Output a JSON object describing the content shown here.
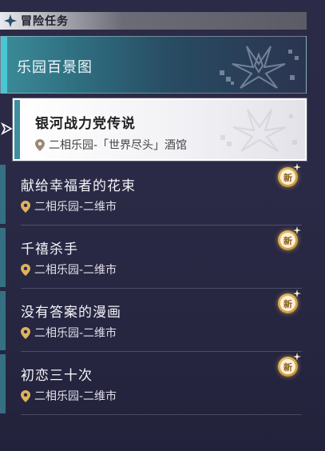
{
  "header": {
    "title": "冒险任务"
  },
  "category": {
    "label": "乐园百景图"
  },
  "selected_quest": {
    "title": "银河战力党传说",
    "location": "二相乐园-「世界尽头」酒馆"
  },
  "quests": [
    {
      "title": "献给幸福者的花束",
      "location": "二相乐园-二维市",
      "badge": "新"
    },
    {
      "title": "千禧杀手",
      "location": "二相乐园-二维市",
      "badge": "新"
    },
    {
      "title": "没有答案的漫画",
      "location": "二相乐园-二维市",
      "badge": "新"
    },
    {
      "title": "初恋三十次",
      "location": "二相乐园-二维市",
      "badge": "新"
    }
  ],
  "colors": {
    "accent_teal": "#49c6d3",
    "badge_gold": "#d39b3a",
    "background": "#2a2a46"
  },
  "icons": {
    "header": "diamond-star-icon",
    "location": "map-pin-icon",
    "pointer": "arrow-right-icon",
    "badge": "new-badge-icon"
  }
}
